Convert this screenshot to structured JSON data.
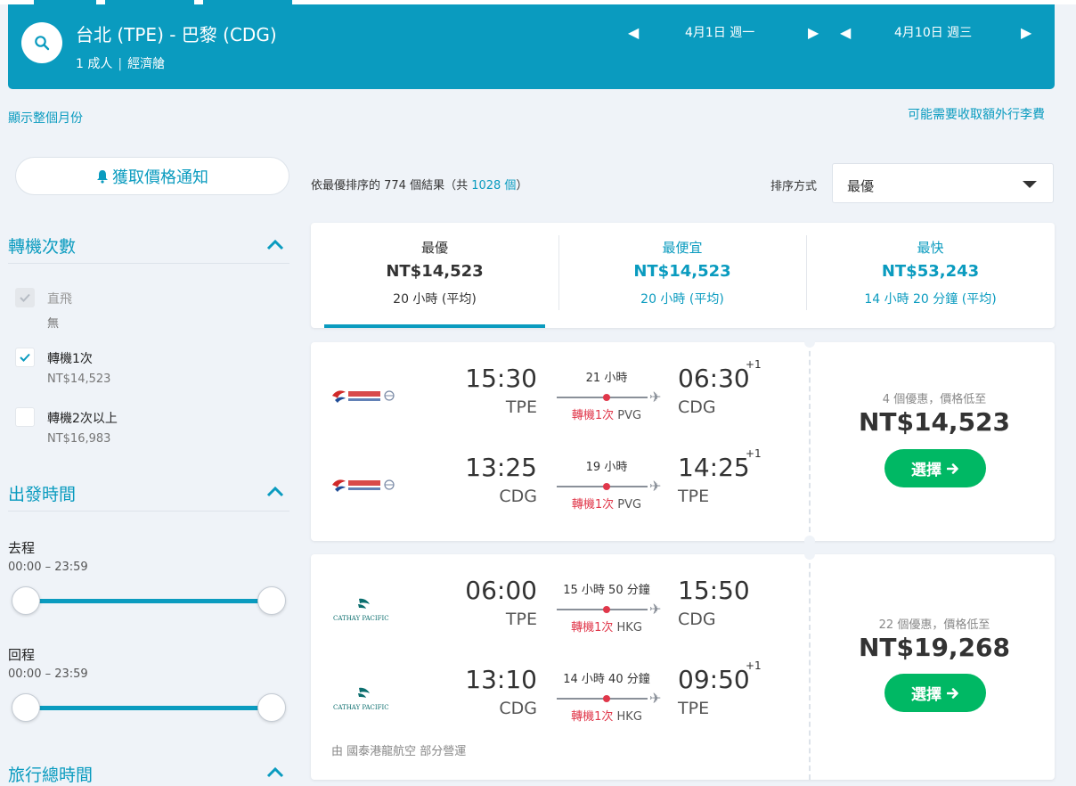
{
  "header": {
    "route": "台北 (TPE) - 巴黎 (CDG)",
    "passengers": "1 成人",
    "cabin": "經濟艙",
    "depart_date": "4月1日 週一",
    "return_date": "4月10日 週三",
    "accent_color": "#0a9bbf"
  },
  "links": {
    "show_month": "顯示整個月份",
    "baggage_fee": "可能需要收取額外行李費"
  },
  "sidebar": {
    "price_alert": "獲取價格通知",
    "stops": {
      "title": "轉機次數",
      "options": [
        {
          "label": "直飛",
          "price": "無",
          "checked": false,
          "disabled": true
        },
        {
          "label": "轉機1次",
          "price": "NT$14,523",
          "checked": true,
          "disabled": false
        },
        {
          "label": "轉機2次以上",
          "price": "NT$16,983",
          "checked": false,
          "disabled": false
        }
      ]
    },
    "departure_time": {
      "title": "出發時間",
      "outbound_label": "去程",
      "outbound_range": "00:00 – 23:59",
      "return_label": "回程",
      "return_range": "00:00 – 23:59"
    },
    "trip_duration": {
      "title": "旅行總時間"
    }
  },
  "results": {
    "count_prefix": "依最優排序的 774 個結果（共 ",
    "total": "1028 個",
    "count_suffix": "）",
    "sort_label": "排序方式",
    "sort_value": "最優"
  },
  "sort_tabs": [
    {
      "title": "最優",
      "price": "NT$14,523",
      "duration": "20 小時 (平均)"
    },
    {
      "title": "最便宜",
      "price": "NT$14,523",
      "duration": "20 小時 (平均)"
    },
    {
      "title": "最快",
      "price": "NT$53,243",
      "duration": "14 小時 20 分鐘 (平均)"
    }
  ],
  "cards": [
    {
      "airline": "China Eastern",
      "legs": [
        {
          "dep_time": "15:30",
          "dep_code": "TPE",
          "arr_time": "06:30",
          "arr_code": "CDG",
          "plus_day": "+1",
          "duration": "21 小時",
          "stops": "轉機1次",
          "stop_airport": "PVG"
        },
        {
          "dep_time": "13:25",
          "dep_code": "CDG",
          "arr_time": "14:25",
          "arr_code": "TPE",
          "plus_day": "+1",
          "duration": "19 小時",
          "stops": "轉機1次",
          "stop_airport": "PVG"
        }
      ],
      "deals": "4 個優惠，價格低至",
      "price": "NT$14,523",
      "select_label": "選擇"
    },
    {
      "airline": "Cathay Pacific",
      "logo_text": "CATHAY PACIFIC",
      "legs": [
        {
          "dep_time": "06:00",
          "dep_code": "TPE",
          "arr_time": "15:50",
          "arr_code": "CDG",
          "plus_day": "",
          "duration": "15 小時 50 分鐘",
          "stops": "轉機1次",
          "stop_airport": "HKG"
        },
        {
          "dep_time": "13:10",
          "dep_code": "CDG",
          "arr_time": "09:50",
          "arr_code": "TPE",
          "plus_day": "+1",
          "duration": "14 小時 40 分鐘",
          "stops": "轉機1次",
          "stop_airport": "HKG"
        }
      ],
      "deals": "22 個優惠，價格低至",
      "price": "NT$19,268",
      "select_label": "選擇",
      "operated_by": "由 國泰港龍航空 部分營運"
    }
  ]
}
